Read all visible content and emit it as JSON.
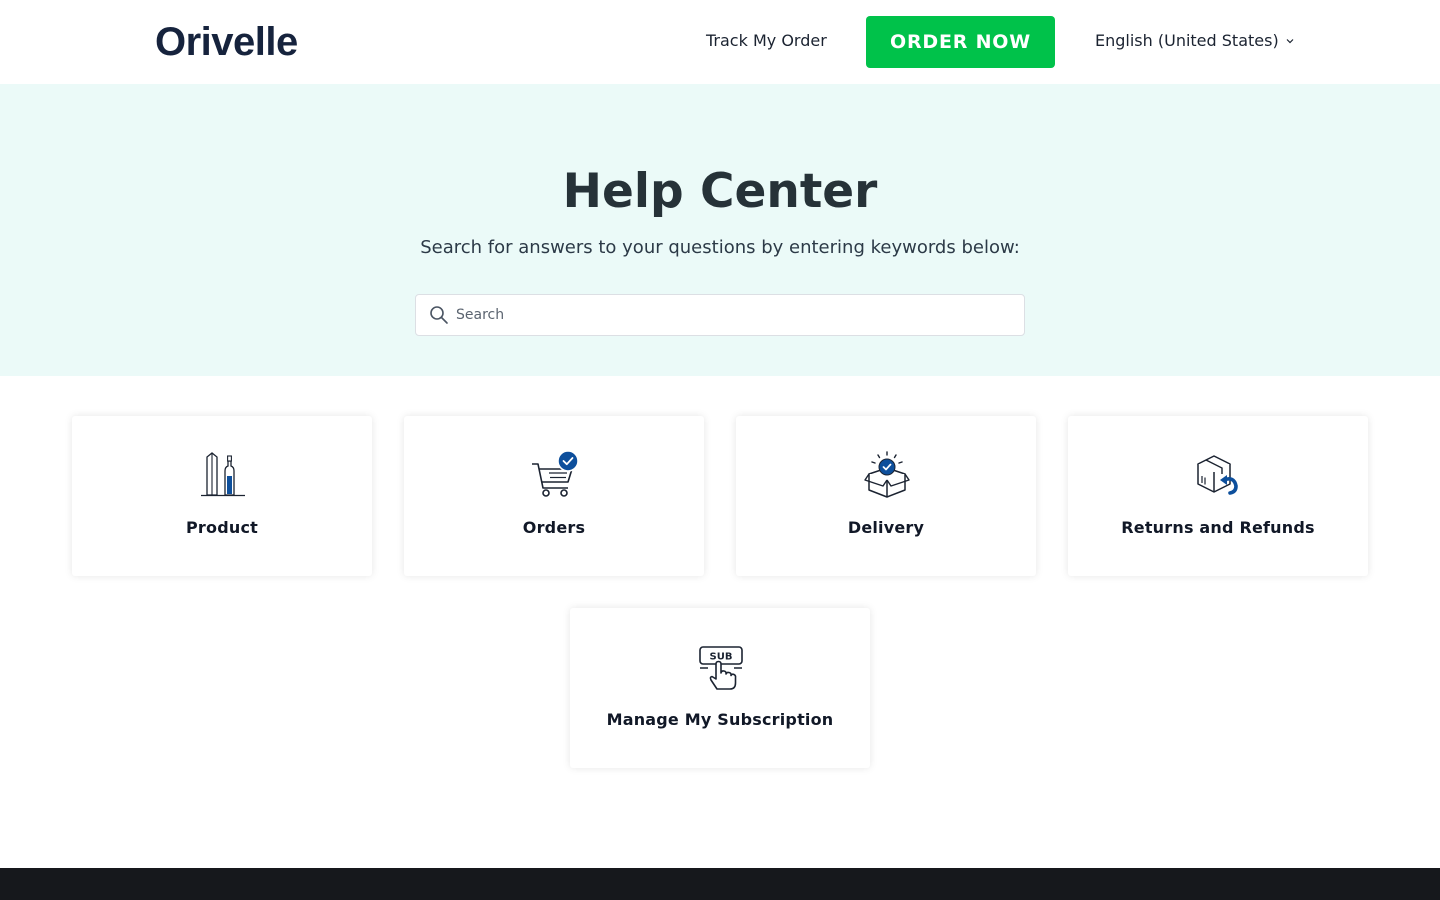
{
  "header": {
    "logo": "Orivelle",
    "track_order": "Track My Order",
    "order_now": "ORDER NOW",
    "language": "English (United States)"
  },
  "hero": {
    "title": "Help Center",
    "subtitle": "Search for answers to your questions by entering keywords below:",
    "search_placeholder": "Search"
  },
  "categories": [
    {
      "label": "Product",
      "icon": "product-bottles-icon"
    },
    {
      "label": "Orders",
      "icon": "cart-check-icon"
    },
    {
      "label": "Delivery",
      "icon": "box-check-icon"
    },
    {
      "label": "Returns and Refunds",
      "icon": "box-return-icon"
    },
    {
      "label": "Manage My Subscription",
      "icon": "subscription-hand-icon"
    }
  ],
  "colors": {
    "accent_green": "#00c24a",
    "hero_background": "#ebfaf8",
    "brand_navy": "#16233d",
    "icon_blue": "#0d4f9c",
    "footer": "#16181c"
  }
}
